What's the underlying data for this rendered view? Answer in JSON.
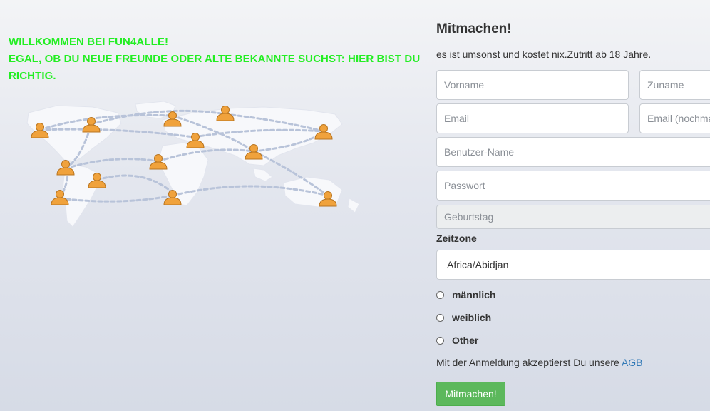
{
  "welcome": {
    "line1": "WILLKOMMEN BEI FUN4ALLE!",
    "line2": "EGAL, OB DU NEUE FREUNDE ODER ALTE BEKANNTE SUCHST: HIER BIST DU RICHTIG."
  },
  "form": {
    "title": "Mitmachen!",
    "subtitle": "es ist umsonst und kostet nix.Zutritt ab 18 Jahre.",
    "firstname_placeholder": "Vorname",
    "lastname_placeholder": "Zuname",
    "email_placeholder": "Email",
    "email_repeat_placeholder": "Email (nochmals)",
    "username_placeholder": "Benutzer-Name",
    "password_placeholder": "Passwort",
    "birthday_placeholder": "Geburtstag",
    "timezone_label": "Zeitzone",
    "timezone_value": "Africa/Abidjan",
    "gender_options": [
      "männlich",
      "weiblich",
      "Other"
    ],
    "agb_text": "Mit der Anmeldung akzeptierst Du unsere",
    "agb_link": "AGB",
    "submit_label": "Mitmachen!"
  },
  "colors": {
    "welcome_text": "#22ee22",
    "submit_button": "#5cb85c",
    "link": "#337ab7",
    "person_icon": "#f0a23c"
  },
  "icons": [
    "world-map-icon",
    "person-icon",
    "connection-lines"
  ]
}
